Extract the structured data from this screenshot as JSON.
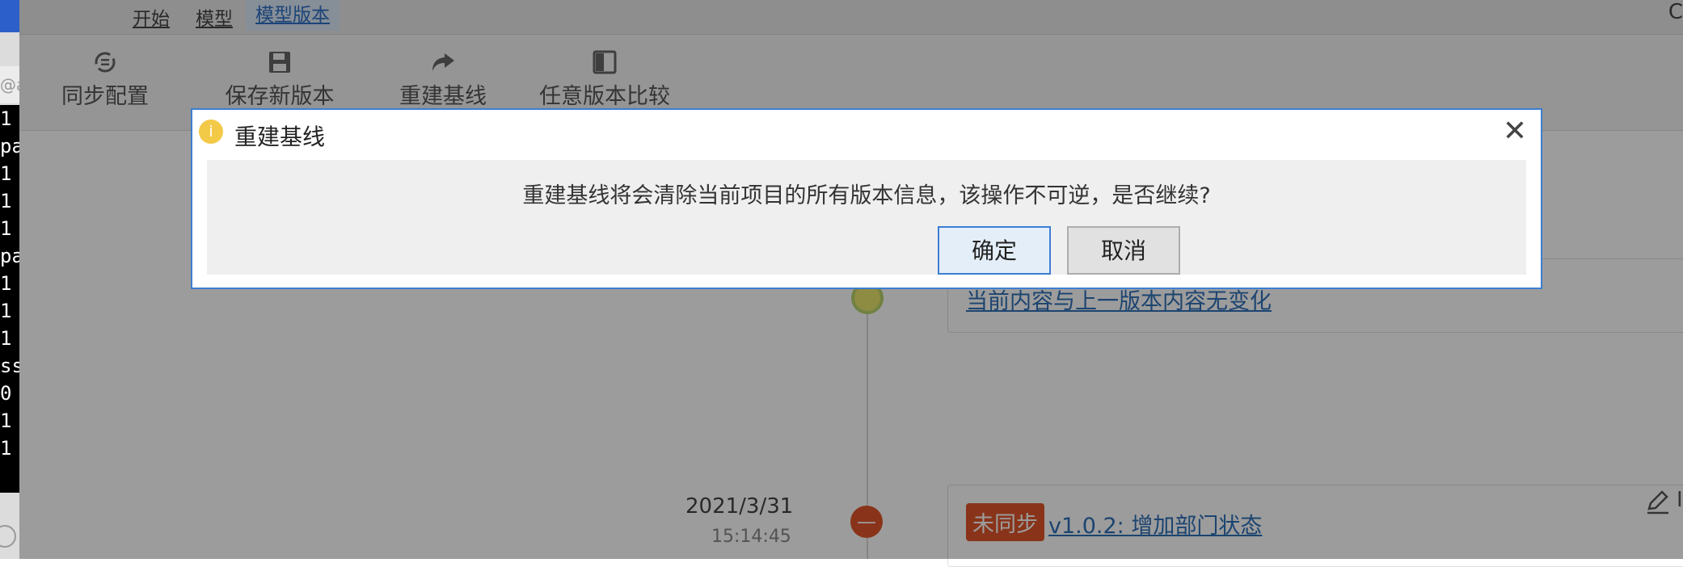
{
  "left_terminal": {
    "address_fragment": "@a",
    "lines": [
      "1",
      "pa",
      "1",
      "1",
      "1",
      "pa",
      "1",
      "1",
      "1",
      "ss",
      "0",
      "1",
      "1"
    ]
  },
  "menubar": {
    "items": [
      "开始",
      "模型",
      "模型版本"
    ],
    "right_fragment": "C"
  },
  "toolbar": {
    "sync_config": "同步配置",
    "save_new_version": "保存新版本",
    "rebuild_baseline": "重建基线",
    "compare_versions": "任意版本比较"
  },
  "timeline": {
    "entries": [
      {
        "card_text": "当前内容与上一版本内容无变化",
        "node_color": "#e9e36e"
      },
      {
        "date": "2021/3/31",
        "time": "15:14:45",
        "badge": "未同步",
        "version_text": "v1.0.2: 增加部门状态",
        "node_symbol": "—",
        "node_color": "#e0552b"
      }
    ],
    "edit_icon": "pencil-icon",
    "edit_fragment": "I"
  },
  "dialog": {
    "title": "重建基线",
    "info_icon_symbol": "i",
    "message": "重建基线将会清除当前项目的所有版本信息，该操作不可逆，是否继续?",
    "confirm": "确定",
    "cancel": "取消",
    "close_symbol": "✕"
  },
  "colors": {
    "accent": "#3c7ed2",
    "overlay": "rgba(0,0,0,0.39)",
    "warning": "#f3c948",
    "badge": "#e0552b"
  }
}
